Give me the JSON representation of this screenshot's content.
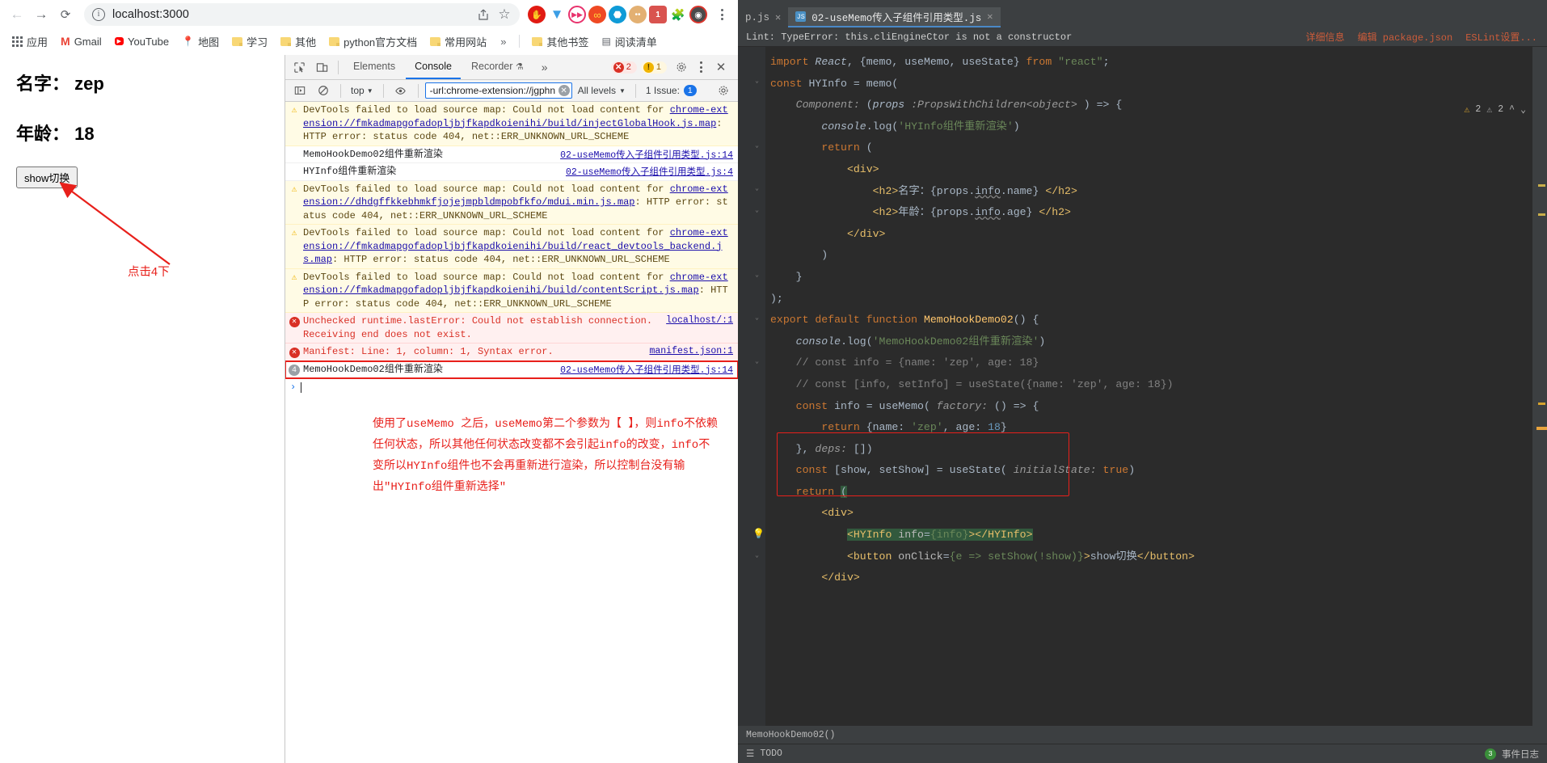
{
  "browser": {
    "nav": {
      "back": "←",
      "forward": "→",
      "reload": "⟳"
    },
    "omnibox": {
      "url": "localhost:3000",
      "info_icon": "i",
      "share_icon": "share-icon",
      "star_icon": "☆"
    },
    "extensions": [
      {
        "name": "adblock-extension-icon",
        "color": "#d9342b",
        "glyph": "✋"
      },
      {
        "name": "vue-devtools-icon",
        "color": "#ffffff",
        "glyph": "▼"
      },
      {
        "name": "video-speed-extension-icon",
        "color": "#ffffff",
        "glyph": "▶▶"
      },
      {
        "name": "infinity-extension-icon",
        "color": "#ef4923",
        "glyph": "∞"
      },
      {
        "name": "azure-extension-icon",
        "color": "#ffffff",
        "glyph": "⬡"
      },
      {
        "name": "cookie-extension-icon",
        "color": "#e0a96d",
        "glyph": "🍪"
      },
      {
        "name": "puzzle-extensions-icon",
        "color": "#d9534f",
        "glyph": "1"
      },
      {
        "name": "jigsaw-extensions-icon",
        "color": "#5f6368",
        "glyph": "🧩"
      },
      {
        "name": "picture-in-picture-icon",
        "color": "#4a4a4a",
        "glyph": "◉"
      }
    ],
    "bookmarks": [
      {
        "label": "应用",
        "icon": "apps-grid-icon"
      },
      {
        "label": "Gmail",
        "icon": "gmail-icon"
      },
      {
        "label": "YouTube",
        "icon": "youtube-icon"
      },
      {
        "label": "地图",
        "icon": "maps-icon"
      },
      {
        "label": "学习",
        "icon": "folder-icon"
      },
      {
        "label": "其他",
        "icon": "folder-icon"
      },
      {
        "label": "python官方文档",
        "icon": "folder-icon"
      },
      {
        "label": "常用网站",
        "icon": "folder-icon"
      }
    ],
    "bookmarks_overflow": "»",
    "bookmarks_right": [
      {
        "label": "其他书签",
        "icon": "folder-icon"
      },
      {
        "label": "阅读清单",
        "icon": "reading-list-icon"
      }
    ]
  },
  "page": {
    "name_line": "名字：  zep",
    "age_line": "年龄：  18",
    "button_label": "show切换",
    "annotation": "点击4下"
  },
  "devtools": {
    "tabs": [
      {
        "label": "Elements",
        "active": false
      },
      {
        "label": "Console",
        "active": true
      },
      {
        "label": "Recorder",
        "active": false,
        "suffix": "🧪"
      }
    ],
    "more_tabs": "»",
    "inspect_icon": "inspect-element-icon",
    "device_icon": "device-toolbar-icon",
    "error_badge": "2",
    "warning_badge": "1",
    "settings_icon": "gear-icon",
    "kebab_icon": "more-options-icon",
    "close_icon": "close-icon",
    "filterbar": {
      "sidebar_icon": "console-sidebar-icon",
      "clear_icon": "clear-console-icon",
      "context": "top",
      "eye_icon": "live-expression-icon",
      "filter_value": "-url:chrome-extension://jgphn",
      "filter_clear": "✕",
      "levels": "All levels",
      "issues_label": "1 Issue:",
      "issues_count": "1",
      "settings_icon": "console-settings-icon"
    },
    "messages": [
      {
        "level": "warn",
        "icon": "warning-icon",
        "text": "DevTools failed to load source map: Could not load content for ",
        "link": "chrome-extension://fmkadmapgofadopljbjfkapdkoienihi/build/injectGlobalHook.js.map",
        "tail": ": HTTP error: status code 404, net::ERR_UNKNOWN_URL_SCHEME",
        "source": ""
      },
      {
        "level": "log",
        "icon": "",
        "text": "MemoHookDemo02组件重新渲染",
        "link": "",
        "tail": "",
        "source": "02-useMemo传入子组件引用类型.js:14"
      },
      {
        "level": "log",
        "icon": "",
        "text": "HYInfo组件重新渲染",
        "link": "",
        "tail": "",
        "source": "02-useMemo传入子组件引用类型.js:4"
      },
      {
        "level": "warn",
        "icon": "warning-icon",
        "text": "DevTools failed to load source map: Could not load content for ",
        "link": "chrome-extension://dhdgffkkebhmkfjojejmpbldmpobfkfo/mdui.min.js.map",
        "tail": ": HTTP error: status code 404, net::ERR_UNKNOWN_URL_SCHEME",
        "source": ""
      },
      {
        "level": "warn",
        "icon": "warning-icon",
        "text": "DevTools failed to load source map: Could not load content for ",
        "link": "chrome-extension://fmkadmapgofadopljbjfkapdkoienihi/build/react_devtools_backend.js.map",
        "tail": ": HTTP error: status code 404, net::ERR_UNKNOWN_URL_SCHEME",
        "source": ""
      },
      {
        "level": "warn",
        "icon": "warning-icon",
        "text": "DevTools failed to load source map: Could not load content for ",
        "link": "chrome-extension://fmkadmapgofadopljbjfkapdkoienihi/build/contentScript.js.map",
        "tail": ": HTTP error: status code 404, net::ERR_UNKNOWN_URL_SCHEME",
        "source": ""
      },
      {
        "level": "error",
        "icon": "error-icon",
        "text": "Unchecked runtime.lastError: Could not establish connection. Receiving end does not exist.",
        "link": "",
        "tail": "",
        "source": "localhost/:1"
      },
      {
        "level": "error",
        "icon": "error-icon",
        "text": "Manifest: Line: 1, column: 1, Syntax error.",
        "link": "",
        "tail": "",
        "source": "manifest.json:1"
      }
    ],
    "highlighted_message": {
      "count": "4",
      "text": "MemoHookDemo02组件重新渲染",
      "source": "02-useMemo传入子组件引用类型.js:14"
    },
    "prompt": "›",
    "note": "使用了useMemo 之后，useMemo第二个参数为【 】，则info不依赖任何状态，所以其他任何状态改变都不会引起info的改变，info不变所以HYInfo组件也不会再重新进行渲染，所以控制台没有输出\"HYInfo组件重新选择\""
  },
  "editor": {
    "tabs": [
      {
        "label": "p.js",
        "active": false,
        "partial": true
      },
      {
        "label": "02-useMemo传入子组件引用类型.js",
        "active": true,
        "partial": false
      }
    ],
    "inspect_message": "Lint: TypeError: this.cliEngineCtor is not a constructor",
    "inspect_links": [
      "详细信息",
      "编辑 package.json",
      "ESLint设置..."
    ],
    "warn_count": "2",
    "weak_count": "2",
    "nav_up": "^",
    "nav_down": "⌄",
    "code_lines": [
      "import React, {memo, useMemo, useState} from \"react\";",
      "const HYInfo = memo(",
      "    Component: (props :PropsWithChildren<object> ) => {",
      "        console.log('HYInfo组件重新渲染')",
      "        return (",
      "            <div>",
      "                <h2>名字：{props.info.name} </h2>",
      "                <h2>年龄：{props.info.age} </h2>",
      "            </div>",
      "        )",
      "    }",
      ");",
      "export default function MemoHookDemo02() {",
      "    console.log('MemoHookDemo02组件重新渲染')",
      "    // const info = {name: 'zep', age: 18}",
      "    // const [info, setInfo] = useState({name: 'zep', age: 18})",
      "    const info = useMemo( factory: () => {",
      "        return {name: 'zep', age: 18}",
      "    }, deps: [])",
      "    const [show, setShow] = useState( initialState: true)",
      "    return (",
      "        <div>",
      "            <HYInfo info={info}></HYInfo>",
      "            <button onClick={e => setShow(!show)}>show切换</button>",
      "        </div>"
    ],
    "status_breadcrumb": "MemoHookDemo02()",
    "bottom_todo": "TODO",
    "bottom_event_log": "事件日志",
    "bottom_event_badge": "3"
  },
  "colors": {
    "accent_blue": "#1a73e8",
    "annotation_red": "#e8201b",
    "error_red": "#d93025",
    "warn_yellow": "#f0b400",
    "editor_bg": "#2b2b2b",
    "editor_chrome": "#3c3f41"
  }
}
